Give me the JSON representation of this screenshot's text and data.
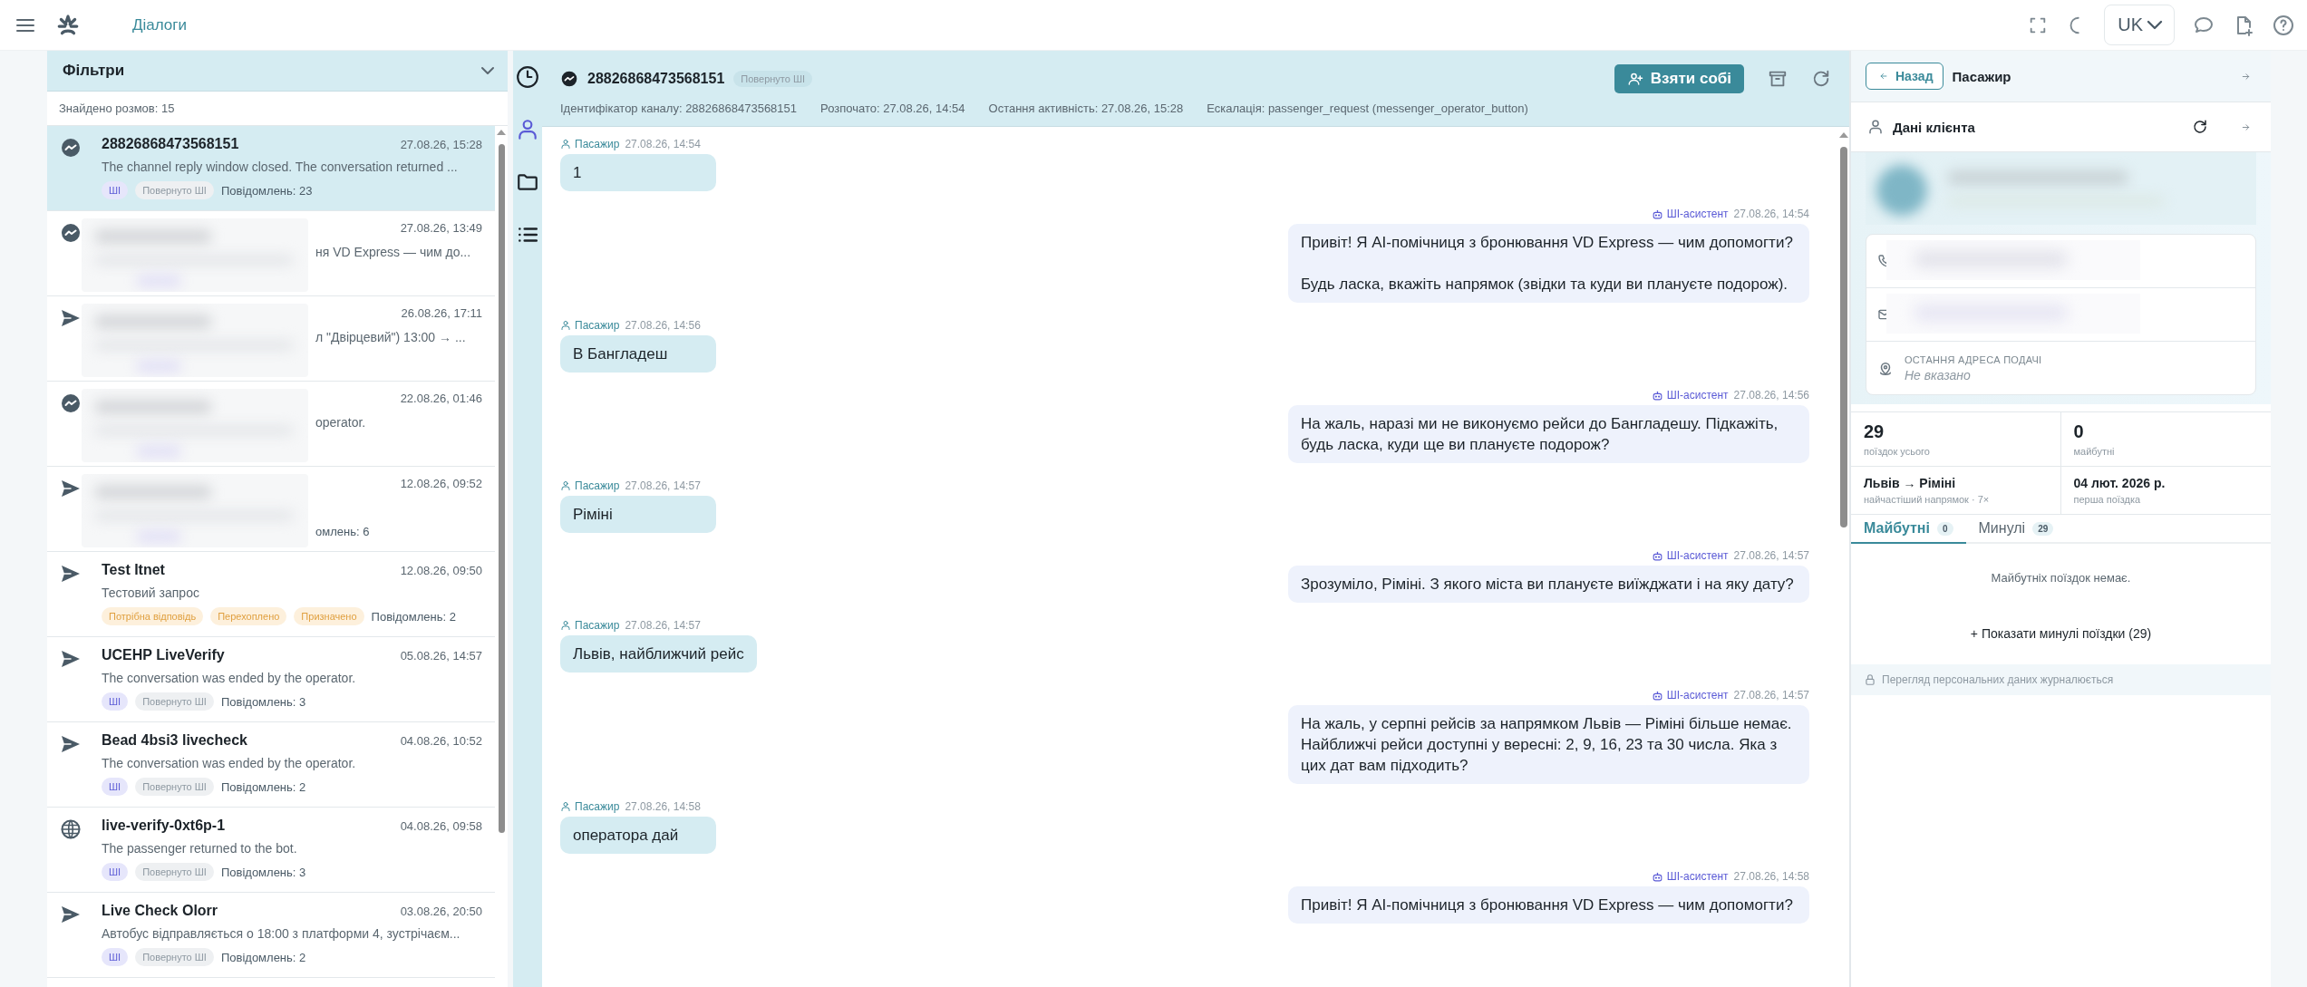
{
  "topbar": {
    "nav_link": "Діалоги",
    "language": "UK"
  },
  "rail": [
    {
      "kind": "clock",
      "selected": false
    },
    {
      "kind": "person",
      "selected": true
    },
    {
      "kind": "folder",
      "selected": false
    },
    {
      "kind": "list",
      "selected": false
    }
  ],
  "filters": {
    "title": "Фільтри"
  },
  "found": "Знайдено розмов: 15",
  "conversations": [
    {
      "kind": "messenger",
      "title": "28826868473568151",
      "time": "27.08.26, 15:28",
      "preview": "The channel reply window closed. The conversation returned ...",
      "tags": [
        {
          "kind": "ai",
          "label": "ШІ"
        },
        {
          "kind": "returned",
          "label": "Повернуто ШІ"
        }
      ],
      "count": "Повідомлень: 23",
      "selected": true,
      "redacted": false
    },
    {
      "kind": "messenger",
      "time": "27.08.26, 13:49",
      "preview": "ня VD Express — чим до...",
      "selected": false,
      "redacted": true
    },
    {
      "kind": "telegram",
      "time": "26.08.26, 17:11",
      "preview": "л \"Двірцевий\") 13:00 → ...",
      "selected": false,
      "redacted": true
    },
    {
      "kind": "messenger",
      "time": "22.08.26, 01:46",
      "preview": "operator.",
      "selected": false,
      "redacted": true
    },
    {
      "kind": "telegram",
      "time": "12.08.26, 09:52",
      "count": "омлень: 6",
      "selected": false,
      "redacted": true
    },
    {
      "kind": "telegram",
      "title": "Test Itnet",
      "time": "12.08.26, 09:50",
      "preview": "Тестовий запрос",
      "tags": [
        {
          "kind": "warning",
          "label": "Потрібна відповідь"
        },
        {
          "kind": "warning",
          "label": "Перехоплено"
        },
        {
          "kind": "warning",
          "label": "Призначено"
        }
      ],
      "count": "Повідомлень: 2",
      "selected": false,
      "redacted": false
    },
    {
      "kind": "telegram",
      "title": "UCEHP LiveVerify",
      "time": "05.08.26, 14:57",
      "preview": "The conversation was ended by the operator.",
      "tags": [
        {
          "kind": "ai",
          "label": "ШІ"
        },
        {
          "kind": "returned",
          "label": "Повернуто ШІ"
        }
      ],
      "count": "Повідомлень: 3",
      "selected": false,
      "redacted": false
    },
    {
      "kind": "telegram",
      "title": "Bead 4bsi3 livecheck",
      "time": "04.08.26, 10:52",
      "preview": "The conversation was ended by the operator.",
      "tags": [
        {
          "kind": "ai",
          "label": "ШІ"
        },
        {
          "kind": "returned",
          "label": "Повернуто ШІ"
        }
      ],
      "count": "Повідомлень: 2",
      "selected": false,
      "redacted": false
    },
    {
      "kind": "web",
      "title": "live-verify-0xt6p-1",
      "time": "04.08.26, 09:58",
      "preview": "The passenger returned to the bot.",
      "tags": [
        {
          "kind": "ai",
          "label": "ШІ"
        },
        {
          "kind": "returned",
          "label": "Повернуто ШІ"
        }
      ],
      "count": "Повідомлень: 3",
      "selected": false,
      "redacted": false
    },
    {
      "kind": "telegram",
      "title": "Live Check Olorr",
      "time": "03.08.26, 20:50",
      "preview": "Автобус відправляється о 18:00 з платформи 4, зустрічаєм...",
      "tags": [
        {
          "kind": "ai",
          "label": "ШІ"
        },
        {
          "kind": "returned",
          "label": "Повернуто ШІ"
        }
      ],
      "count": "Повідомлень: 2",
      "selected": false,
      "redacted": false
    }
  ],
  "chat": {
    "kind": "messenger",
    "title": "28826868473568151",
    "badge": "Повернуто ШІ",
    "take_button": "Взяти собі",
    "meta": [
      "Ідентифікатор каналу: 28826868473568151",
      "Розпочато: 27.08.26, 14:54",
      "Остання активність: 27.08.26, 15:28",
      "Ескалація: passenger_request (messenger_operator_button)"
    ],
    "messages": [
      {
        "kind": "passenger",
        "author": "Пасажир",
        "time": "27.08.26, 14:54",
        "text": "1"
      },
      {
        "kind": "assistant",
        "author": "ШІ-асистент",
        "time": "27.08.26, 14:54",
        "text": "Привіт! Я AI-помічниця з бронювання VD Express — чим допомогти?\n\nБудь ласка, вкажіть напрямок (звідки та куди ви плануєте подорож)."
      },
      {
        "kind": "passenger",
        "author": "Пасажир",
        "time": "27.08.26, 14:56",
        "text": "В Бангладеш"
      },
      {
        "kind": "assistant",
        "author": "ШІ-асистент",
        "time": "27.08.26, 14:56",
        "text": "На жаль, наразі ми не виконуємо рейси до Бангладешу. Підкажіть, будь ласка, куди ще ви плануєте подорож?"
      },
      {
        "kind": "passenger",
        "author": "Пасажир",
        "time": "27.08.26, 14:57",
        "text": "Ріміні"
      },
      {
        "kind": "assistant",
        "author": "ШІ-асистент",
        "time": "27.08.26, 14:57",
        "text": "Зрозуміло, Ріміні. З якого міста ви плануєте виїжджати і на яку дату?"
      },
      {
        "kind": "passenger",
        "author": "Пасажир",
        "time": "27.08.26, 14:57",
        "text": "Львів, найближчий рейс"
      },
      {
        "kind": "assistant",
        "author": "ШІ-асистент",
        "time": "27.08.26, 14:57",
        "text": "На жаль, у серпні рейсів за напрямком Львів — Ріміні більше немає. Найближчі рейси доступні у вересні: 2, 9, 16, 23 та 30 числа. Яка з цих дат вам підходить?"
      },
      {
        "kind": "passenger",
        "author": "Пасажир",
        "time": "27.08.26, 14:58",
        "text": "оператора дай"
      },
      {
        "kind": "assistant",
        "author": "ШІ-асистент",
        "time": "27.08.26, 14:58",
        "text": "Привіт! Я AI-помічниця з бронювання VD Express — чим допомогти?"
      }
    ]
  },
  "client": {
    "back": "Назад",
    "title": "Пасажир",
    "section": "Дані клієнта",
    "address_label": "ОСТАННЯ АДРЕСА ПОДАЧІ",
    "address_value": "Не вказано",
    "stats": [
      {
        "value": "29",
        "label": "поїздок усього"
      },
      {
        "value": "0",
        "label": "майбутні"
      },
      {
        "value": "Львів → Ріміні",
        "label": "найчастіший напрямок · 7×"
      },
      {
        "value": "04 лют. 2026 р.",
        "label": "перша поїздка"
      }
    ],
    "tabs": [
      {
        "label": "Майбутні",
        "count": "0",
        "selected": true
      },
      {
        "label": "Минулі",
        "count": "29",
        "selected": false
      }
    ],
    "empty": "Майбутніх поїздок немає.",
    "show_past": "+ Показати минулі поїздки (29)",
    "footer": "Перегляд персональних даних журналюється"
  }
}
